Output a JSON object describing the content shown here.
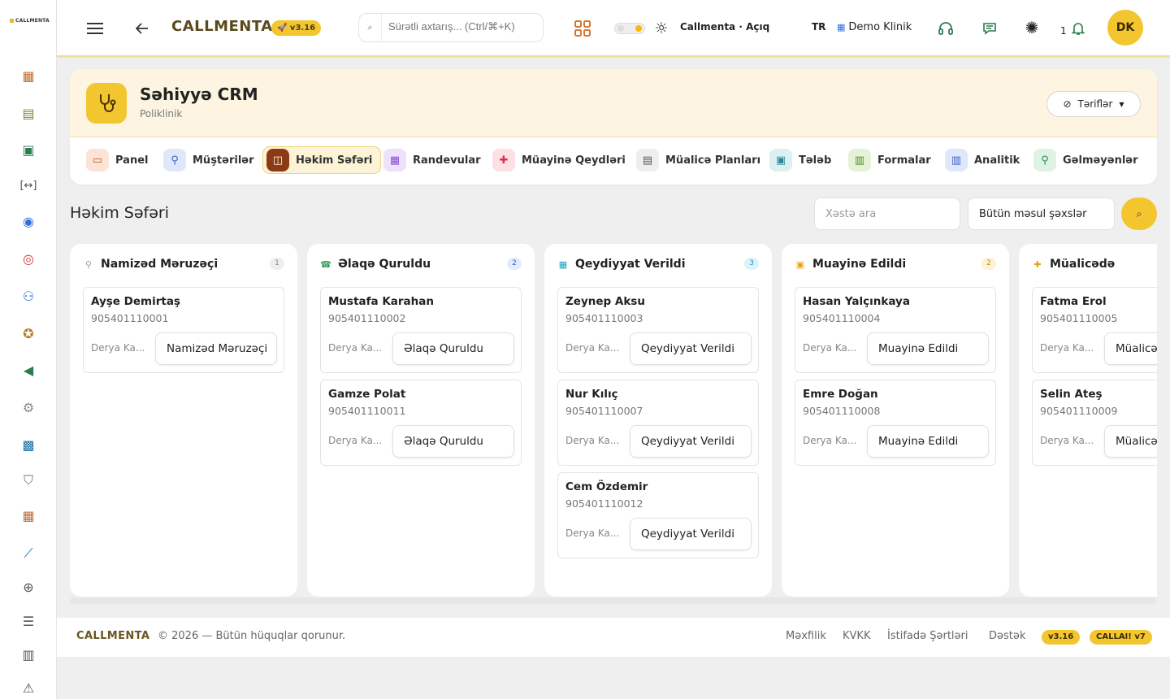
{
  "sidebar": {
    "logo_text": "CALLMENTA",
    "icons": [
      "calendar-grid-icon",
      "clipboard-icon",
      "id-card-icon",
      "code-brackets-icon",
      "user-circle-icon",
      "alarm-icon",
      "chat-user-icon",
      "medal-icon",
      "megaphone-icon",
      "settings-badge-icon",
      "grid-board-icon",
      "shield-icon",
      "building-icon",
      "line-chart-icon",
      "globe-icon",
      "sliders-icon",
      "bar-chart-icon",
      "warning-icon"
    ]
  },
  "topbar": {
    "brand": "CALLMENTA",
    "version": "🚀 v3.16",
    "search_placeholder": "Sürətli axtarış... (Ctrl/⌘+K)",
    "status_text": "Callmenta · Açıq",
    "lang": "TR",
    "clinic": "Demo Klinik",
    "notif_count": "1",
    "avatar_initials": "DK"
  },
  "module": {
    "title": "Səhiyyə CRM",
    "subtitle": "Poliklinik",
    "defs_label": "Təriflər",
    "tabs": [
      {
        "label": "Panel",
        "icon": "▭",
        "bg": "#fde2d6",
        "color": "#c0562b"
      },
      {
        "label": "Müştərilər",
        "icon": "👤",
        "bg": "#dfe7fb",
        "color": "#3f62c9"
      },
      {
        "label": "Həkim Səfəri",
        "icon": "◫",
        "bg": "#8b3a13",
        "color": "#fff"
      },
      {
        "label": "Randevular",
        "icon": "▦",
        "bg": "#ede1fb",
        "color": "#8b4ad6"
      },
      {
        "label": "Müayinə Qeydləri",
        "icon": "✚",
        "bg": "#fde0e4",
        "color": "#d6324a"
      },
      {
        "label": "Müalicə Planları",
        "icon": "▤",
        "bg": "#eeeeee",
        "color": "#555"
      },
      {
        "label": "Tələb",
        "icon": "▣",
        "bg": "#dcf0f2",
        "color": "#26899a"
      },
      {
        "label": "Formalar",
        "icon": "▥",
        "bg": "#e6f2d6",
        "color": "#4d8b22"
      },
      {
        "label": "Analitik",
        "icon": "▥",
        "bg": "#dfe7fb",
        "color": "#3f62c9"
      },
      {
        "label": "Gəlməyənlər",
        "icon": "👤",
        "bg": "#dff3e4",
        "color": "#2c8f4c"
      }
    ]
  },
  "page": {
    "title": "Həkim Səfəri",
    "patient_search_placeholder": "Xəstə ara",
    "owner_filter": "Bütün məsul şəxslər"
  },
  "columns": [
    {
      "title": "Namizəd Məruzəçi",
      "count": "1",
      "icon": "👤",
      "color": "#9e9e9e",
      "badge_bg": "#eeeeee",
      "badge_fg": "#888",
      "cards": [
        {
          "name": "Ayşe Demirtaş",
          "phone": "905401110001",
          "owner": "Derya Ka...",
          "stage": "Namizəd Məruzəçi"
        }
      ]
    },
    {
      "title": "Əlaqə Quruldu",
      "count": "2",
      "icon": "☎",
      "color": "#2e9a52",
      "badge_bg": "#e3ebfd",
      "badge_fg": "#3f62c9",
      "cards": [
        {
          "name": "Mustafa Karahan",
          "phone": "905401110002",
          "owner": "Derya Ka...",
          "stage": "Əlaqə Quruldu"
        },
        {
          "name": "Gamze Polat",
          "phone": "905401110011",
          "owner": "Derya Ka...",
          "stage": "Əlaqə Quruldu"
        }
      ]
    },
    {
      "title": "Qeydiyyat Verildi",
      "count": "3",
      "icon": "▦",
      "color": "#1aa3c2",
      "badge_bg": "#dcf3f8",
      "badge_fg": "#1a9ab7",
      "cards": [
        {
          "name": "Zeynep Aksu",
          "phone": "905401110003",
          "owner": "Derya Ka...",
          "stage": "Qeydiyyat Verildi"
        },
        {
          "name": "Nur Kılıç",
          "phone": "905401110007",
          "owner": "Derya Ka...",
          "stage": "Qeydiyyat Verildi"
        },
        {
          "name": "Cem Özdemir",
          "phone": "905401110012",
          "owner": "Derya Ka...",
          "stage": "Qeydiyyat Verildi"
        }
      ]
    },
    {
      "title": "Muayinə Edildi",
      "count": "2",
      "icon": "▣",
      "color": "#e8a317",
      "badge_bg": "#fdf1d6",
      "badge_fg": "#c8891a",
      "cards": [
        {
          "name": "Hasan Yalçınkaya",
          "phone": "905401110004",
          "owner": "Derya Ka...",
          "stage": "Muayinə Edildi"
        },
        {
          "name": "Emre Doğan",
          "phone": "905401110008",
          "owner": "Derya Ka...",
          "stage": "Muayinə Edildi"
        }
      ]
    },
    {
      "title": "Müalicədə",
      "count": "",
      "icon": "✚",
      "color": "#e8a317",
      "badge_bg": "#fdf1d6",
      "badge_fg": "#c8891a",
      "cards": [
        {
          "name": "Fatma Erol",
          "phone": "905401110005",
          "owner": "Derya Ka...",
          "stage": "Müalicədə"
        },
        {
          "name": "Selin Ateş",
          "phone": "905401110009",
          "owner": "Derya Ka...",
          "stage": "Müalicədə"
        }
      ]
    }
  ],
  "footer": {
    "brand": "CALLMENTA",
    "copyright": "© 2026 — Bütün hüquqlar qorunur.",
    "links": [
      "Məxfilik",
      "KVKK",
      "İstifadə Şərtləri",
      "Dəstək"
    ],
    "version_pill": "v3.16",
    "ai_pill": "CALLAI! v7"
  },
  "colors": {
    "accent": "#f3c62f",
    "brand_text": "#5b4a1e",
    "active_tab": "#8b3a13"
  }
}
